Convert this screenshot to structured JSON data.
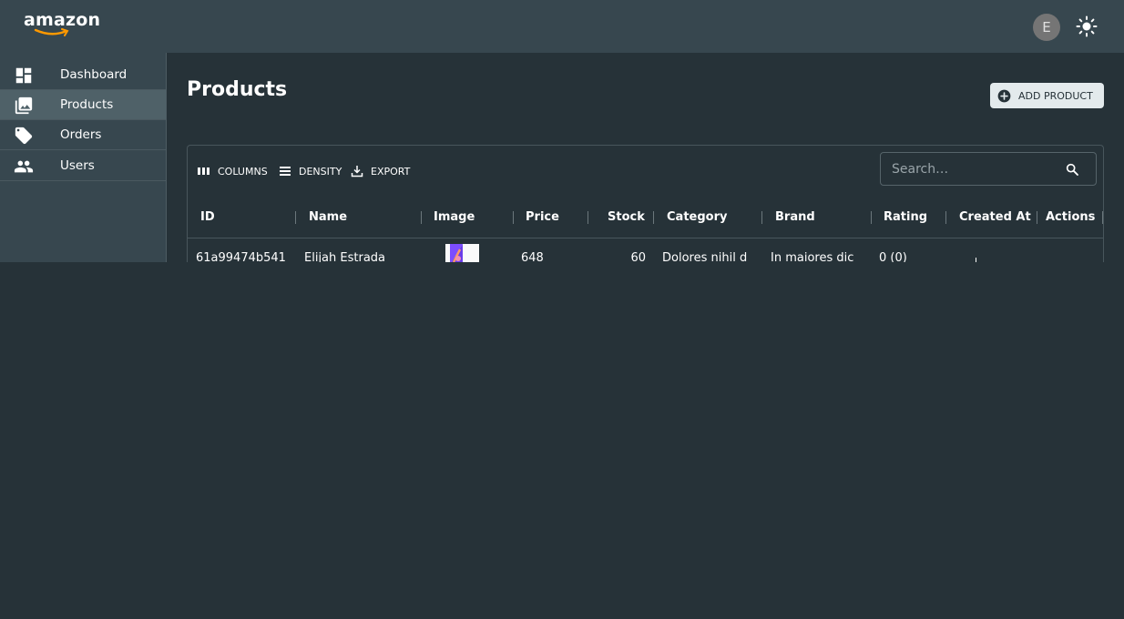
{
  "brand": {
    "logo_text": "amazon",
    "accent": "#ff9900"
  },
  "header": {
    "avatar_initial": "E",
    "theme_icon": "sun-icon"
  },
  "sidebar": {
    "items": [
      {
        "label": "Dashboard",
        "icon": "dashboard-icon",
        "active": false
      },
      {
        "label": "Products",
        "icon": "image-icon",
        "active": true
      },
      {
        "label": "Orders",
        "icon": "tag-icon",
        "active": false
      },
      {
        "label": "Users",
        "icon": "users-icon",
        "active": false
      }
    ]
  },
  "page": {
    "title": "Products",
    "add_button_label": "ADD PRODUCT"
  },
  "grid": {
    "toolbar": {
      "columns_label": "COLUMNS",
      "density_label": "DENSITY",
      "export_label": "EXPORT"
    },
    "search": {
      "placeholder": "Search…"
    },
    "columns": [
      "ID",
      "Name",
      "Image",
      "Price",
      "Stock",
      "Category",
      "Brand",
      "Rating",
      "Created At",
      "Actions"
    ],
    "rows": [
      {
        "id": "61a99474b541",
        "name": "Elijah Estrada",
        "price": "648",
        "stock": "60",
        "category": "Dolores nihil d",
        "brand": "In maiores dic",
        "rating": "0 (0)",
        "created_at": "",
        "actions": ""
      }
    ]
  },
  "colors": {
    "background": "#263238",
    "topbar": "#37474f",
    "active_nav": "#4f6168",
    "button": "#e3eaec"
  }
}
